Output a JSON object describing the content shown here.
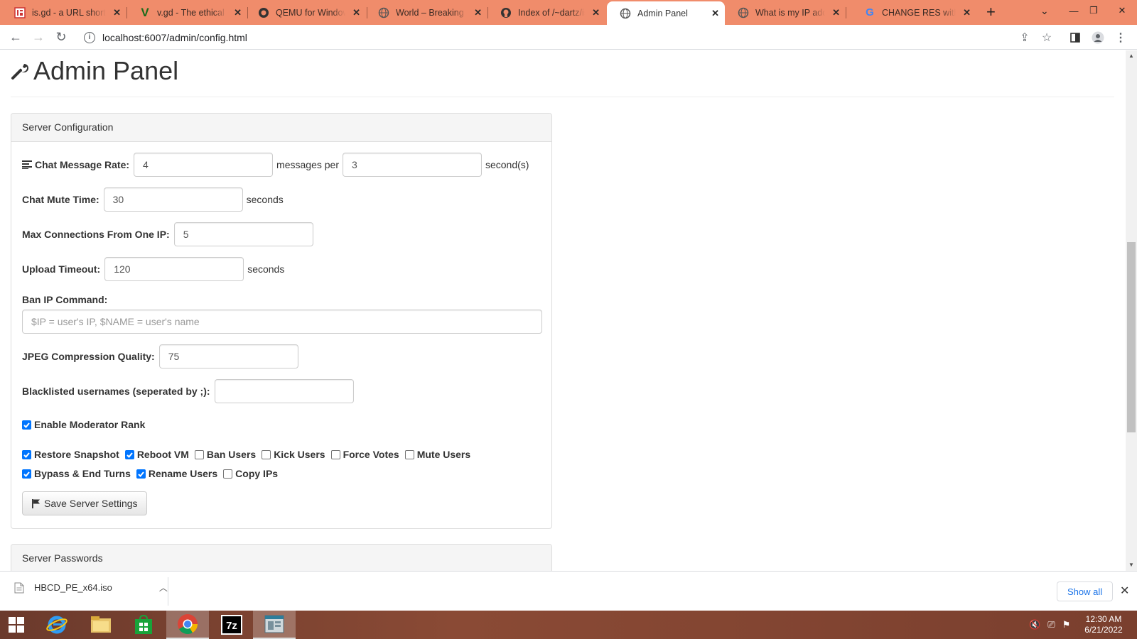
{
  "browser": {
    "tabs": [
      {
        "title": "is.gd - a URL shortener",
        "icon": "isgd-icon"
      },
      {
        "title": "v.gd - The ethical URL",
        "icon": "vgd-icon"
      },
      {
        "title": "QEMU for Windows",
        "icon": "qemu-icon"
      },
      {
        "title": "World – Breaking news",
        "icon": "globe-icon"
      },
      {
        "title": "Index of /~dartz/isos",
        "icon": "github-icon"
      },
      {
        "title": "Admin Panel",
        "icon": "globe-icon",
        "active": true
      },
      {
        "title": "What is my IP address",
        "icon": "globe-icon"
      },
      {
        "title": "CHANGE RES without",
        "icon": "google-icon"
      }
    ],
    "url": "localhost:6007/admin/config.html"
  },
  "page": {
    "title": "Admin Panel",
    "server_config": {
      "heading": "Server Configuration",
      "chat_rate": {
        "label": "Chat Message Rate:",
        "messages": "4",
        "messages_unit": "messages per",
        "seconds": "3",
        "seconds_unit": "second(s)"
      },
      "chat_mute": {
        "label": "Chat Mute Time:",
        "value": "30",
        "unit": "seconds"
      },
      "max_conn": {
        "label": "Max Connections From One IP:",
        "value": "5"
      },
      "upload_timeout": {
        "label": "Upload Timeout:",
        "value": "120",
        "unit": "seconds"
      },
      "ban_ip": {
        "label": "Ban IP Command:",
        "placeholder": "$IP = user's IP, $NAME = user's name",
        "value": ""
      },
      "jpeg": {
        "label": "JPEG Compression Quality:",
        "value": "75"
      },
      "blacklist": {
        "label": "Blacklisted usernames (seperated by ;):",
        "value": ""
      },
      "enable_mod": {
        "label": "Enable Moderator Rank",
        "checked": true
      },
      "permissions": [
        {
          "label": "Restore Snapshot",
          "checked": true
        },
        {
          "label": "Reboot VM",
          "checked": true
        },
        {
          "label": "Ban Users",
          "checked": false
        },
        {
          "label": "Kick Users",
          "checked": false
        },
        {
          "label": "Force Votes",
          "checked": false
        },
        {
          "label": "Mute Users",
          "checked": false
        },
        {
          "label": "Bypass & End Turns",
          "checked": true
        },
        {
          "label": "Rename Users",
          "checked": true
        },
        {
          "label": "Copy IPs",
          "checked": false
        }
      ],
      "save_label": "Save Server Settings"
    },
    "server_passwords": {
      "heading": "Server Passwords"
    }
  },
  "downloads": {
    "file": "HBCD_PE_x64.iso",
    "show_all": "Show all"
  },
  "taskbar": {
    "time": "12:30 AM",
    "date": "6/21/2022"
  }
}
